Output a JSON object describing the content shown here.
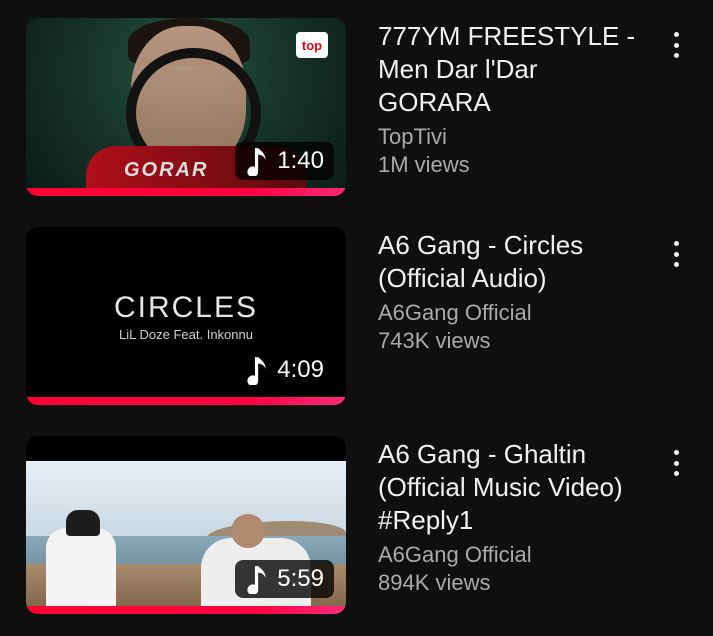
{
  "videos": [
    {
      "title": "777YM FREESTYLE - Men Dar l'Dar GORARA",
      "channel": "TopTivi",
      "views": "1M views",
      "duration": "1:40",
      "thumb_logo": "top",
      "thumb_brand": "GORAR"
    },
    {
      "title": "A6 Gang - Circles (Official Audio)",
      "channel": "A6Gang Official",
      "views": "743K views",
      "duration": "4:09",
      "thumb_title": "CIRCLES",
      "thumb_subtitle": "LiL Doze Feat. Inkonnu"
    },
    {
      "title": "A6 Gang - Ghaltin (Official Music Video) #Reply1",
      "channel": "A6Gang Official",
      "views": "894K views",
      "duration": "5:59"
    }
  ],
  "icons": {
    "duration_icon": "music-note-icon",
    "more_icon": "more-vert-icon"
  },
  "colors": {
    "background": "#0f0f0f",
    "progress": "#ff0033",
    "secondary_text": "#aaaaaa"
  }
}
